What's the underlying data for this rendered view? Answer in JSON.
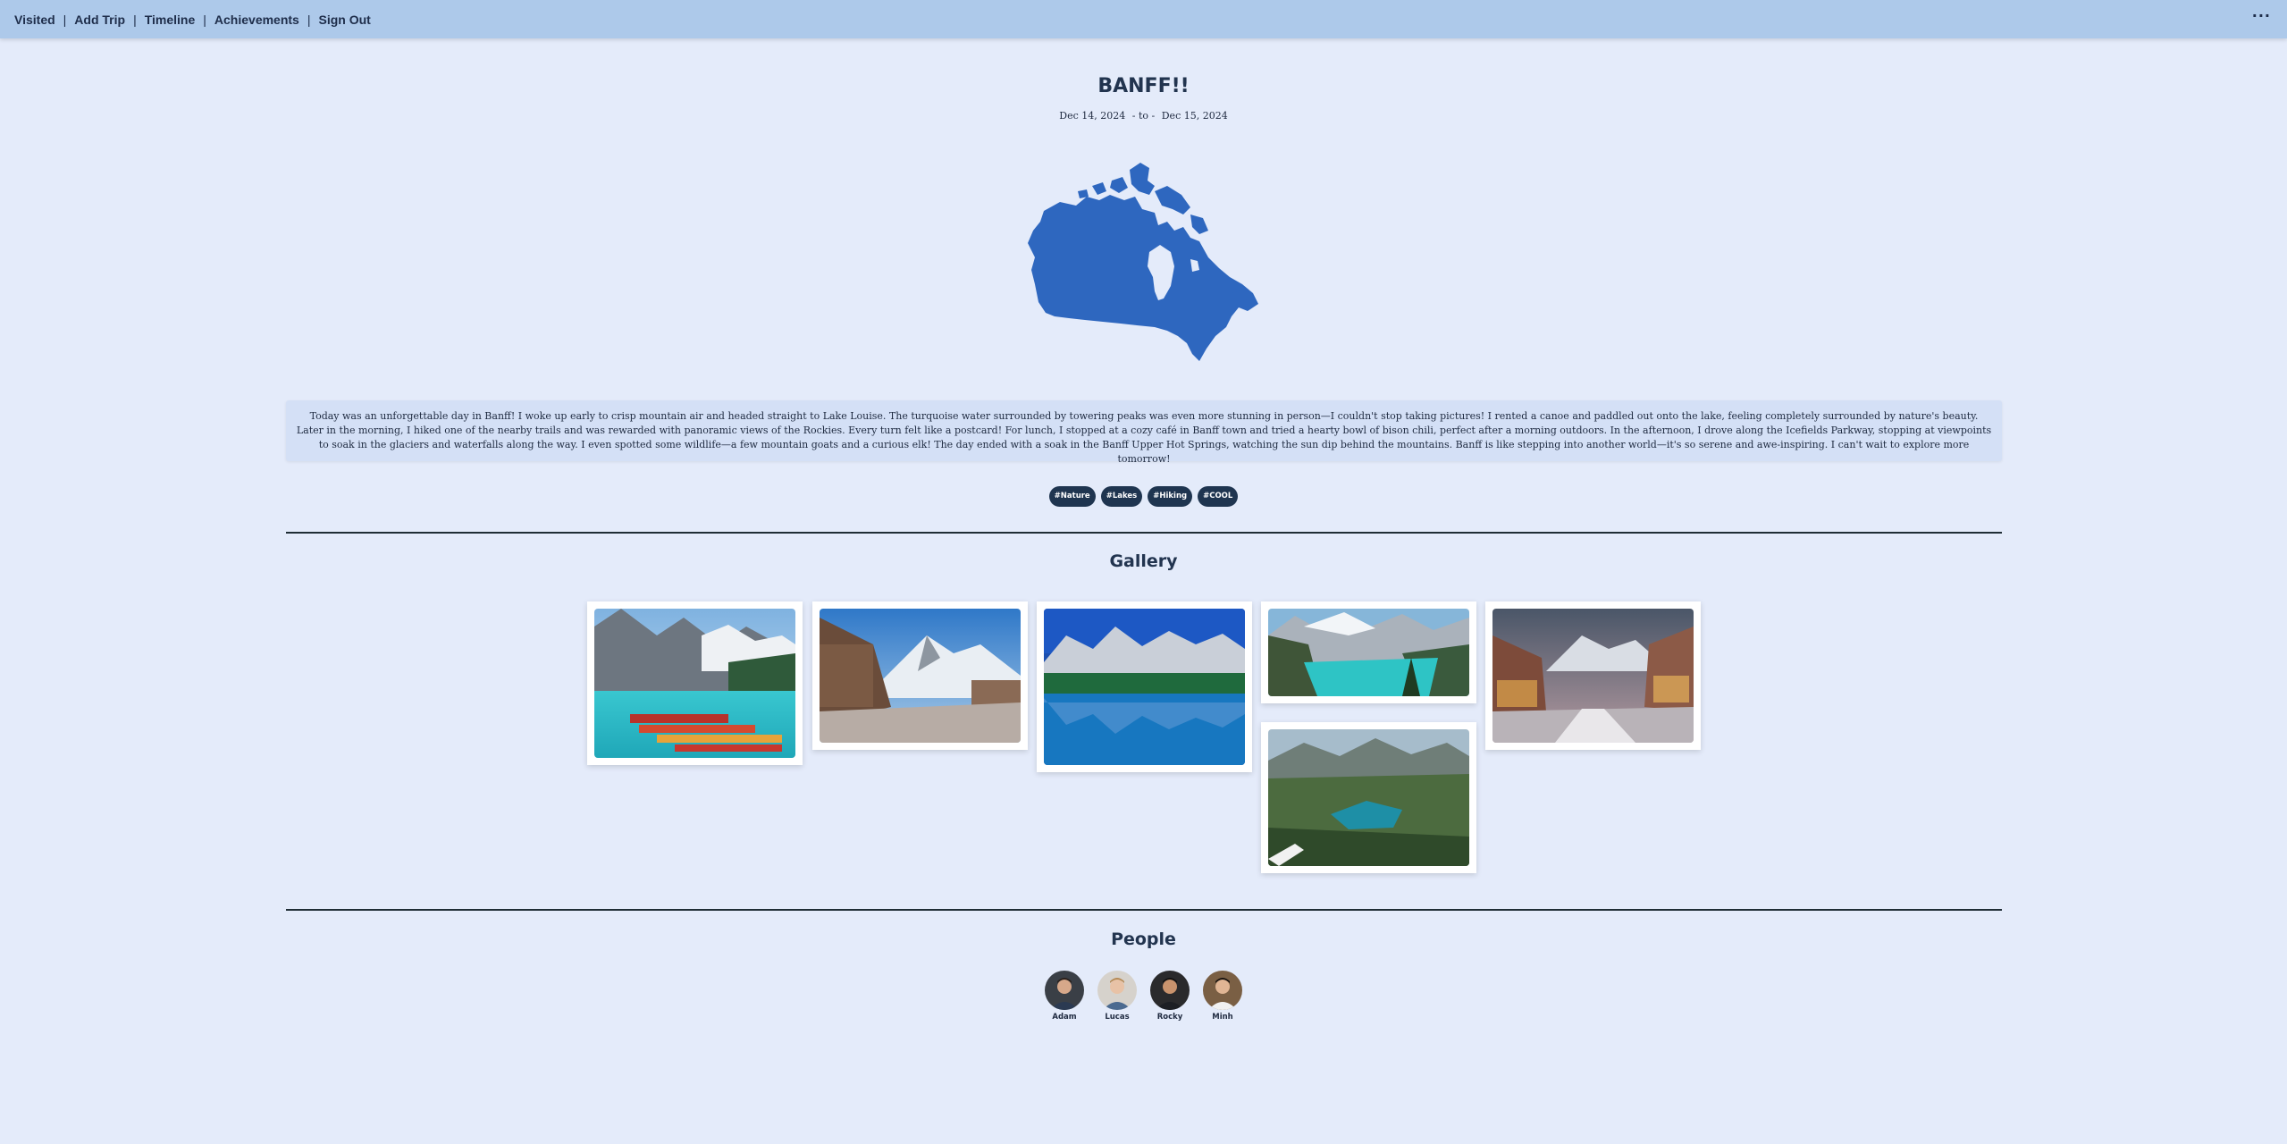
{
  "nav": {
    "items": [
      "Visited",
      "Add Trip",
      "Timeline",
      "Achievements",
      "Sign Out"
    ],
    "separator": "|",
    "more_icon": "more-horizontal-icon",
    "more_glyph": "···"
  },
  "trip": {
    "title": "BANFF!!",
    "start_date": "Dec 14, 2024",
    "date_separator": "- to -",
    "end_date": "Dec 15, 2024",
    "map_image": "canada-map",
    "map_color": "#2e67bf",
    "story": "Today was an unforgettable day in Banff! I woke up early to crisp mountain air and headed straight to Lake Louise. The turquoise water surrounded by towering peaks was even more stunning in person—I couldn't stop taking pictures! I rented a canoe and paddled out onto the lake, feeling completely surrounded by nature's beauty. Later in the morning, I hiked one of the nearby trails and was rewarded with panoramic views of the Rockies. Every turn felt like a postcard! For lunch, I stopped at a cozy café in Banff town and tried a hearty bowl of bison chili, perfect after a morning outdoors. In the afternoon, I drove along the Icefields Parkway, stopping at viewpoints to soak in the glaciers and waterfalls along the way. I even spotted some wildlife—a few mountain goats and a curious elk! The day ended with a soak in the Banff Upper Hot Springs, watching the sun dip behind the mountains. Banff is like stepping into another world—it's so serene and awe-inspiring. I can't wait to explore more tomorrow!",
    "tags": [
      "#Nature",
      "#Lakes",
      "#Hiking",
      "#COOL"
    ]
  },
  "gallery": {
    "title": "Gallery",
    "photos": [
      {
        "name": "lake-canoes-photo"
      },
      {
        "name": "banff-street-photo"
      },
      {
        "name": "blue-lake-reflection-photo"
      },
      {
        "name": "moraine-lake-photo"
      },
      {
        "name": "alpine-lake-valley-photo"
      },
      {
        "name": "banff-town-evening-photo"
      }
    ]
  },
  "people": {
    "title": "People",
    "list": [
      {
        "name": "Adam"
      },
      {
        "name": "Lucas"
      },
      {
        "name": "Rocky"
      },
      {
        "name": "Minh"
      }
    ]
  },
  "colors": {
    "background": "#e4ebfa",
    "topbar": "#adc9ea",
    "tag_bg": "#1f3550",
    "heading": "#22344f"
  }
}
